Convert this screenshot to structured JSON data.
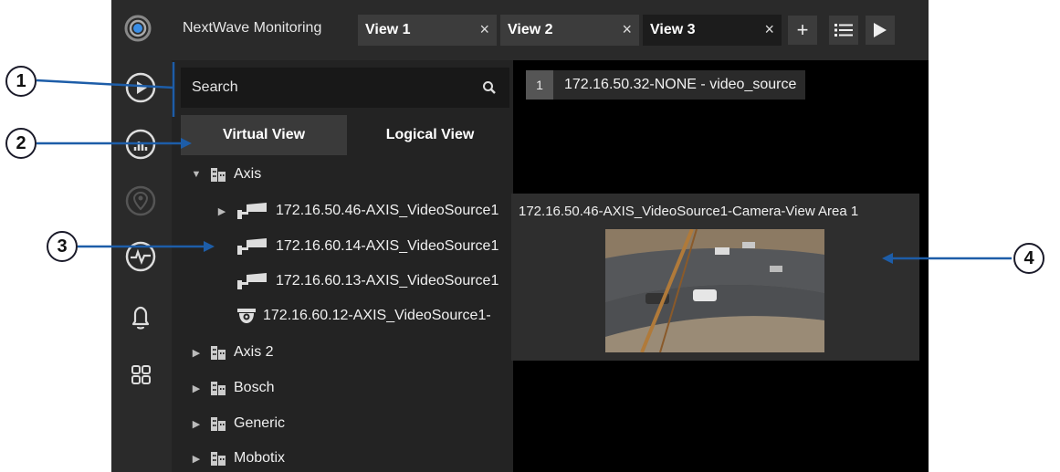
{
  "app": {
    "title": "NextWave Monitoring"
  },
  "tabs": [
    {
      "label": "View 1",
      "close": "×"
    },
    {
      "label": "View 2",
      "close": "×"
    },
    {
      "label": "View 3",
      "close": "×"
    }
  ],
  "toolbar": {
    "add": "+",
    "list_icon": "list-icon",
    "play_icon": "play-icon"
  },
  "rail": [
    "play-circle-icon",
    "equalizer-icon",
    "location-pin-icon",
    "heartbeat-icon",
    "bell-icon",
    "grid-icon"
  ],
  "panel": {
    "search_placeholder": "Search",
    "tabs": {
      "virtual": "Virtual View",
      "logical": "Logical View"
    },
    "tree": [
      {
        "label": "Axis",
        "expanded": true,
        "children": [
          {
            "label": "172.16.50.46-AXIS_VideoSource1",
            "type": "bullet-camera",
            "expander": true
          },
          {
            "label": "172.16.60.14-AXIS_VideoSource1",
            "type": "bullet-camera"
          },
          {
            "label": "172.16.60.13-AXIS_VideoSource1",
            "type": "bullet-camera"
          },
          {
            "label": "172.16.60.12-AXIS_VideoSource1-",
            "type": "dome-camera"
          }
        ]
      },
      {
        "label": "Axis 2",
        "expanded": false
      },
      {
        "label": "Bosch",
        "expanded": false
      },
      {
        "label": "Generic",
        "expanded": false
      },
      {
        "label": "Mobotix",
        "expanded": false
      }
    ]
  },
  "viewer": {
    "slot_number": "1",
    "slot_label": "172.16.50.32-NONE - video_source"
  },
  "tooltip": {
    "title": "172.16.50.46-AXIS_VideoSource1-Camera-View Area 1"
  },
  "callouts": [
    "1",
    "2",
    "3",
    "4"
  ],
  "colors": {
    "accent": "#1d5da8",
    "background": "#161616",
    "panel": "#232323"
  }
}
